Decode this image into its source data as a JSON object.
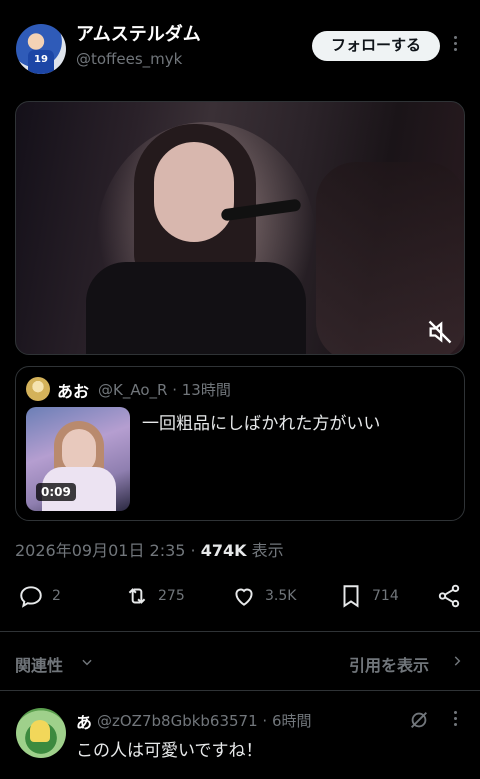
{
  "author": {
    "display_name": "アムステルダム",
    "handle": "@toffees_myk",
    "avatar_number": "19"
  },
  "follow_label": "フォローする",
  "quoted_post": {
    "display_name": "あお",
    "handle_time": "@K_Ao_R · 13時間",
    "video_duration": "0:09",
    "text": "一回粗品にしばかれた方がいい"
  },
  "meta": {
    "timestamp": "2026年09月01日 2:35 · ",
    "views": "474K",
    "views_label": " 表示"
  },
  "actions": {
    "replies": "2",
    "reposts": "275",
    "likes": "3.5K",
    "bookmarks": "714"
  },
  "related_label": "関連性",
  "view_quotes_label": "引用を表示",
  "reply": {
    "display_name": "あ",
    "handle_time": "@zOZ7b8Gbkb63571 · 6時間",
    "text": "この人は可愛いですね！"
  },
  "icons": [
    "more-icon",
    "mute-icon",
    "reply-icon",
    "repost-icon",
    "like-icon",
    "bookmark-icon",
    "share-icon",
    "chevron-down-icon",
    "chevron-right-icon",
    "grok-icon"
  ],
  "colors": {
    "background": "#000000",
    "secondary_text": "#71767b",
    "primary_text": "#e7e9ea",
    "border": "#2f3336",
    "follow_bg": "#eff3f4"
  }
}
